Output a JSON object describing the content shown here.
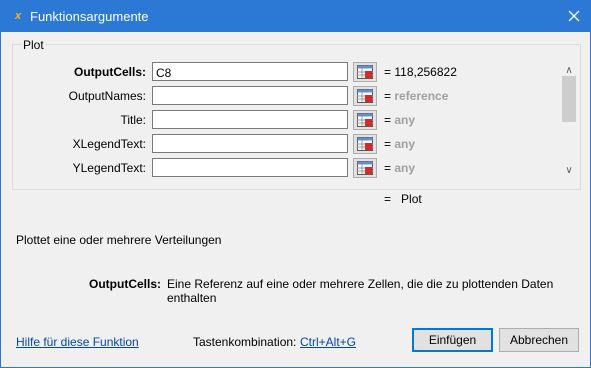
{
  "window": {
    "title": "Funktionsargumente",
    "icon": "excel-fx-icon"
  },
  "group": {
    "title": "Plot"
  },
  "arguments": [
    {
      "name": "OutputCells:",
      "value": "C8",
      "result_prefix": "=",
      "result": "118,256822",
      "bold": true
    },
    {
      "name": "OutputNames:",
      "value": "",
      "result_prefix": "=",
      "result": "reference",
      "bold": false
    },
    {
      "name": "Title:",
      "value": "",
      "result_prefix": "=",
      "result": "any",
      "bold": false
    },
    {
      "name": "XLegendText:",
      "value": "",
      "result_prefix": "=",
      "result": "any",
      "bold": false
    },
    {
      "name": "YLegendText:",
      "value": "",
      "result_prefix": "=",
      "result": "any",
      "bold": false
    }
  ],
  "formula_result": {
    "prefix": "=",
    "value": "Plot"
  },
  "description": "Plottet eine oder mehrere Verteilungen",
  "argument_help": {
    "name": "OutputCells:",
    "text": "Eine Referenz auf eine oder mehrere Zellen, die die zu plottenden Daten enthalten"
  },
  "footer": {
    "help_link": "Hilfe für diese Funktion",
    "shortcut_label": "Tastenkombination:",
    "shortcut_value": "Ctrl+Alt+G",
    "ok_label": "Einfügen",
    "cancel_label": "Abbrechen"
  },
  "colors": {
    "titlebar": "#2b79d4",
    "link": "#0645ad",
    "accent": "#0078d7"
  }
}
